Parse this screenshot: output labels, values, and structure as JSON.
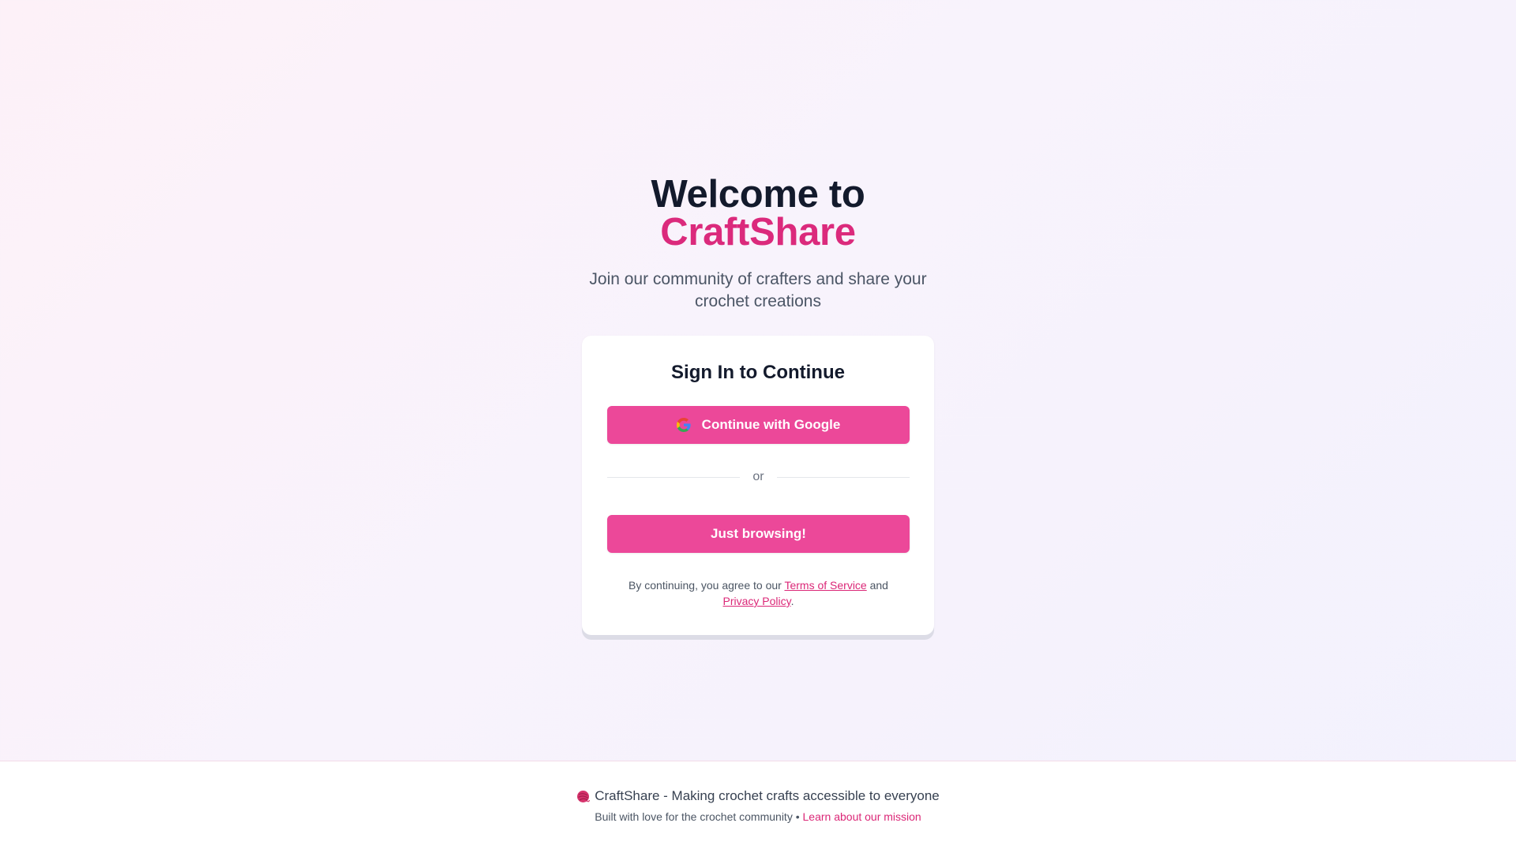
{
  "hero": {
    "title_line1": "Welcome to",
    "title_line2": "CraftShare",
    "subtitle": "Join our community of crafters and share your crochet creations"
  },
  "card": {
    "title": "Sign In to Continue",
    "google_button_label": "Continue with Google",
    "divider_label": "or",
    "browse_button_label": "Just browsing!",
    "terms": {
      "prefix": "By continuing, you agree to our ",
      "terms_link": "Terms of Service",
      "middle": " and",
      "privacy_link": "Privacy Policy",
      "suffix": "."
    }
  },
  "footer": {
    "icon": "yarn-ball-icon",
    "tagline": "CraftShare - Making crochet crafts accessible to everyone",
    "built_with": "Built with love for the crochet community",
    "separator": "•",
    "mission_link": "Learn about our mission"
  },
  "colors": {
    "accent": "#ec4899",
    "brand_text": "#db2a7c",
    "heading": "#131a2c"
  }
}
